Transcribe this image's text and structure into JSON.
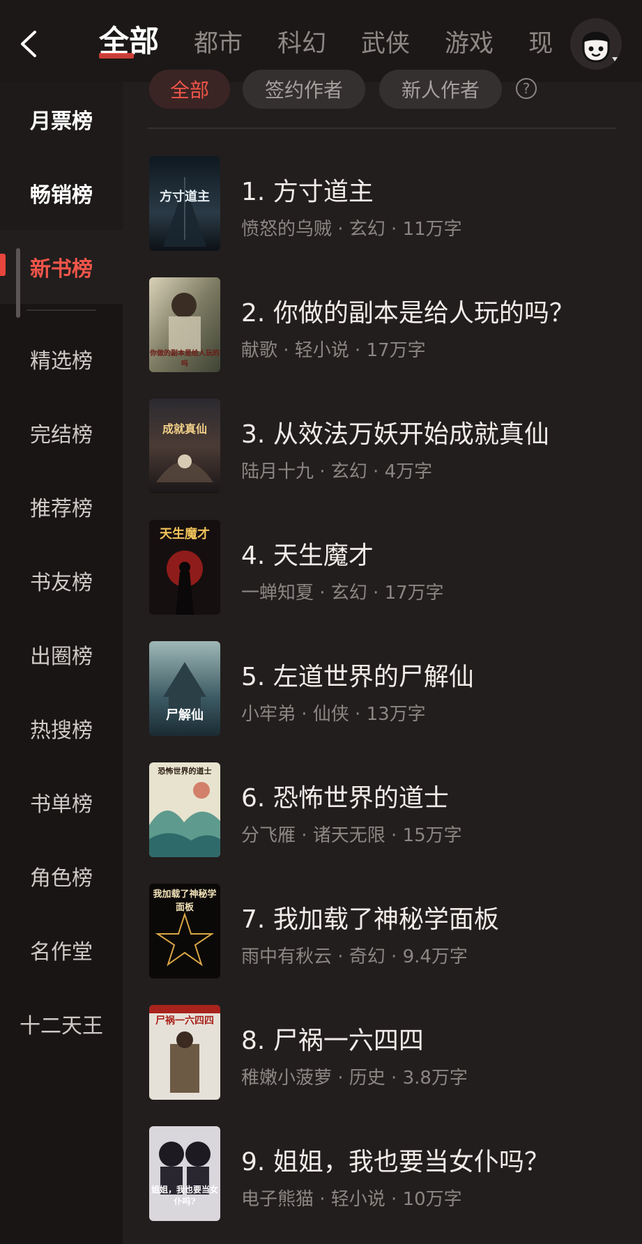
{
  "category_tabs": [
    "全部",
    "都市",
    "科幻",
    "武侠",
    "游戏",
    "现"
  ],
  "sidebar": {
    "items": [
      "月票榜",
      "畅销榜",
      "新书榜",
      "精选榜",
      "完结榜",
      "推荐榜",
      "书友榜",
      "出圈榜",
      "热搜榜",
      "书单榜",
      "角色榜",
      "名作堂",
      "十二天王"
    ],
    "active": "新书榜"
  },
  "filters": {
    "chips": [
      "全部",
      "签约作者",
      "新人作者"
    ],
    "help": "?"
  },
  "books": [
    {
      "rank": "1.",
      "title": "方寸道主",
      "meta": "愤怒的乌贼 · 玄幻 · 11万字",
      "cover_text": "方寸道主"
    },
    {
      "rank": "2.",
      "title": "你做的副本是给人玩的吗？",
      "meta": "献歌 · 轻小说 · 17万字",
      "cover_text": "你做的副本是给人玩的吗"
    },
    {
      "rank": "3.",
      "title": "从效法万妖开始成就真仙",
      "meta": "陆月十九 · 玄幻 · 4万字",
      "cover_text": "成就真仙"
    },
    {
      "rank": "4.",
      "title": "天生魔才",
      "meta": "一蝉知夏 · 玄幻 · 17万字",
      "cover_text": "天生魔才"
    },
    {
      "rank": "5.",
      "title": "左道世界的尸解仙",
      "meta": "小牢弟 · 仙侠 · 13万字",
      "cover_text": "尸解仙"
    },
    {
      "rank": "6.",
      "title": "恐怖世界的道士",
      "meta": "分飞雁 · 诸天无限 · 15万字",
      "cover_text": "恐怖世界的道士"
    },
    {
      "rank": "7.",
      "title": "我加载了神秘学面板",
      "meta": "雨中有秋云 · 奇幻 · 9.4万字",
      "cover_text": "我加载了神秘学面板"
    },
    {
      "rank": "8.",
      "title": "尸祸一六四四",
      "meta": "稚嫩小菠萝 · 历史 · 3.8万字",
      "cover_text": "尸祸一六四四"
    },
    {
      "rank": "9.",
      "title": "姐姐，我也要当女仆吗？",
      "meta": "电子熊猫 · 轻小说 · 10万字",
      "cover_text": "姐姐，我也要当女仆吗?"
    }
  ],
  "colors": {
    "accent": "#e8453c",
    "background": "#221e1d",
    "sidebar": "#181514"
  },
  "icons": {
    "back": "chevron-left-icon",
    "avatar": "user-avatar-icon"
  }
}
